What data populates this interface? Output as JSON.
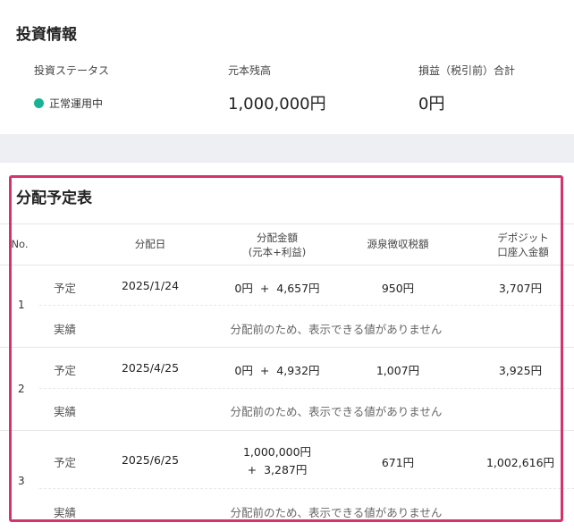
{
  "investment": {
    "title": "投資情報",
    "status_label": "投資ステータス",
    "status_value": "正常運用中",
    "status_color": "#19b394",
    "principal_label": "元本残高",
    "principal_value": "1,000,000円",
    "profit_label": "損益（税引前）合計",
    "profit_value": "0円"
  },
  "schedule": {
    "title": "分配予定表",
    "headers": {
      "no": "No.",
      "date": "分配日",
      "amount_line1": "分配金額",
      "amount_line2": "(元本+利益)",
      "tax": "源泉徴収税額",
      "deposit_line1": "デポジット",
      "deposit_line2": "口座入金額"
    },
    "rows": [
      {
        "no": "1",
        "plan_label": "予定",
        "date": "2025/1/24",
        "principal": "0円",
        "plus": "+",
        "profit": "4,657円",
        "tax": "950円",
        "deposit": "3,707円",
        "actual_label": "実績",
        "actual_note": "分配前のため、表示できる値がありません"
      },
      {
        "no": "2",
        "plan_label": "予定",
        "date": "2025/4/25",
        "principal": "0円",
        "plus": "+",
        "profit": "4,932円",
        "tax": "1,007円",
        "deposit": "3,925円",
        "actual_label": "実績",
        "actual_note": "分配前のため、表示できる値がありません"
      },
      {
        "no": "3",
        "plan_label": "予定",
        "date": "2025/6/25",
        "principal": "1,000,000円",
        "plus": "+",
        "profit": "3,287円",
        "tax": "671円",
        "deposit": "1,002,616円",
        "actual_label": "実績",
        "actual_note": "分配前のため、表示できる値がありません"
      }
    ]
  }
}
